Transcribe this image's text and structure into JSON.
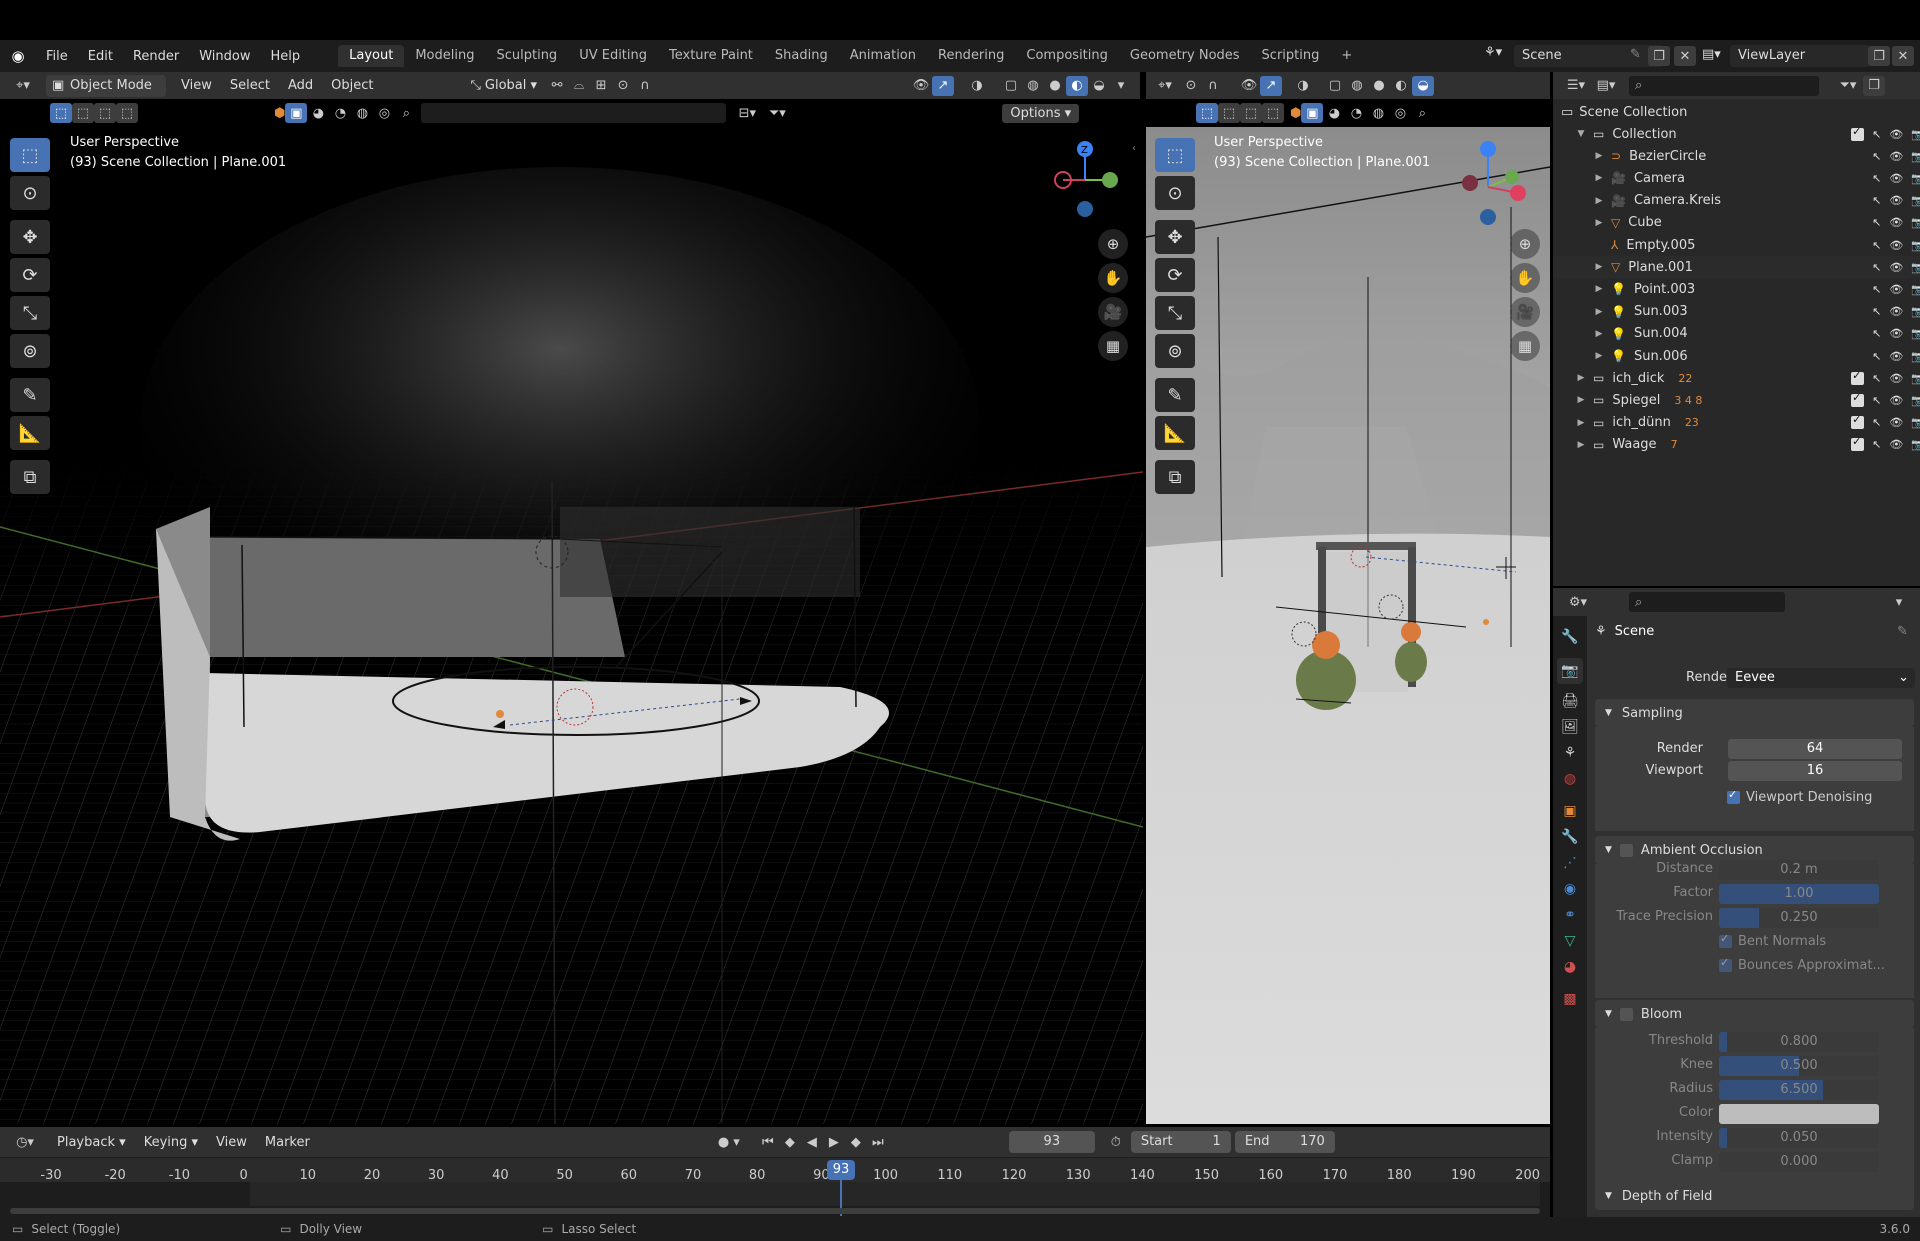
{
  "topbar": {
    "menus": [
      "File",
      "Edit",
      "Render",
      "Window",
      "Help"
    ],
    "workspaces": [
      "Layout",
      "Modeling",
      "Sculpting",
      "UV Editing",
      "Texture Paint",
      "Shading",
      "Animation",
      "Rendering",
      "Compositing",
      "Geometry Nodes",
      "Scripting"
    ],
    "active_workspace": "Layout",
    "scene": "Scene",
    "view_layer": "ViewLayer"
  },
  "viewport_left": {
    "mode": "Object Mode",
    "menus": [
      "View",
      "Select",
      "Add",
      "Object"
    ],
    "orientation": "Global",
    "options": "Options",
    "overlay_line1": "User Perspective",
    "overlay_line2": "(93) Scene Collection | Plane.001"
  },
  "viewport_right": {
    "overlay_line1": "User Perspective",
    "overlay_line2": "(93) Scene Collection | Plane.001"
  },
  "outliner": {
    "root": "Scene Collection",
    "rows": [
      {
        "name": "Collection",
        "level": 1,
        "icon": "collection-icon",
        "expanded": true,
        "check": true
      },
      {
        "name": "BezierCircle",
        "level": 2,
        "icon": "curve-icon"
      },
      {
        "name": "Camera",
        "level": 2,
        "icon": "camera-icon"
      },
      {
        "name": "Camera.Kreis",
        "level": 2,
        "icon": "camera-icon"
      },
      {
        "name": "Cube",
        "level": 2,
        "icon": "mesh-icon"
      },
      {
        "name": "Empty.005",
        "level": 2,
        "icon": "empty-icon"
      },
      {
        "name": "Plane.001",
        "level": 2,
        "icon": "mesh-icon",
        "selected": true
      },
      {
        "name": "Point.003",
        "level": 2,
        "icon": "light-icon"
      },
      {
        "name": "Sun.003",
        "level": 2,
        "icon": "light-icon"
      },
      {
        "name": "Sun.004",
        "level": 2,
        "icon": "light-icon"
      },
      {
        "name": "Sun.006",
        "level": 2,
        "icon": "light-icon"
      },
      {
        "name": "ich_dick",
        "level": 1,
        "icon": "collection-icon",
        "check": true,
        "badge": "22"
      },
      {
        "name": "Spiegel",
        "level": 1,
        "icon": "collection-icon",
        "check": true,
        "badge": "3 4 8"
      },
      {
        "name": "ich_dünn",
        "level": 1,
        "icon": "collection-icon",
        "check": true,
        "badge": "23"
      },
      {
        "name": "Waage",
        "level": 1,
        "icon": "collection-icon",
        "check": true,
        "badge": "7"
      }
    ]
  },
  "properties": {
    "context": "Scene",
    "render_engine_label": "Render Engine",
    "render_engine": "Eevee",
    "sampling": {
      "title": "Sampling",
      "render_label": "Render",
      "render": "64",
      "viewport_label": "Viewport",
      "viewport": "16",
      "denoise": "Viewport Denoising"
    },
    "ao": {
      "title": "Ambient Occlusion",
      "distance_label": "Distance",
      "distance": "0.2 m",
      "factor_label": "Factor",
      "factor": "1.00",
      "factor_fill": 1.0,
      "trace_label": "Trace Precision",
      "trace": "0.250",
      "trace_fill": 0.25,
      "bent": "Bent Normals",
      "bounces": "Bounces Approximat..."
    },
    "bloom": {
      "title": "Bloom",
      "threshold_label": "Threshold",
      "threshold": "0.800",
      "threshold_fill": 0.05,
      "knee_label": "Knee",
      "knee": "0.500",
      "knee_fill": 0.5,
      "radius_label": "Radius",
      "radius": "6.500",
      "radius_fill": 0.65,
      "color_label": "Color",
      "intensity_label": "Intensity",
      "intensity": "0.050",
      "intensity_fill": 0.05,
      "clamp_label": "Clamp",
      "clamp": "0.000"
    },
    "dof": {
      "title": "Depth of Field"
    }
  },
  "timeline": {
    "menus": [
      "Playback",
      "Keying",
      "View",
      "Marker"
    ],
    "current_frame": "93",
    "start_label": "Start",
    "start": "1",
    "end_label": "End",
    "end": "170",
    "ticks": [
      "-30",
      "-20",
      "-10",
      "0",
      "10",
      "20",
      "30",
      "40",
      "50",
      "60",
      "70",
      "80",
      "90",
      "100",
      "110",
      "120",
      "130",
      "140",
      "150",
      "160",
      "170",
      "180",
      "190",
      "200"
    ]
  },
  "statusbar": {
    "select": "Select (Toggle)",
    "dolly": "Dolly View",
    "lasso": "Lasso Select",
    "version": "3.6.0"
  },
  "colors": {
    "accent": "#4772b3",
    "panel": "#303030",
    "header": "#1d1d1d",
    "icon_orange": "#e08a3a",
    "icon_green": "#3fb88a"
  }
}
